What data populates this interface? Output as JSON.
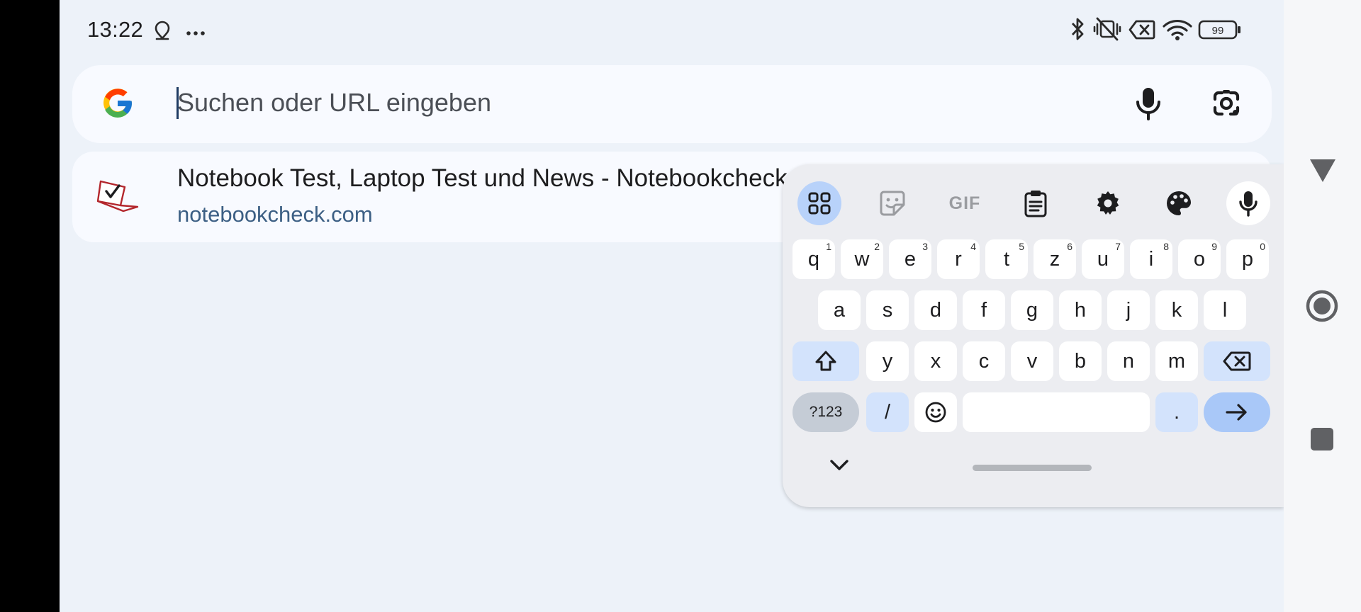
{
  "status_bar": {
    "time": "13:22",
    "battery": "99",
    "icons": [
      "location-icon",
      "more-dots-icon",
      "bluetooth-icon",
      "vibrate-off-icon",
      "no-sim-icon",
      "wifi-icon",
      "battery-icon"
    ]
  },
  "search": {
    "placeholder": "Suchen oder URL eingeben",
    "value": "",
    "icons": [
      "google-logo-icon",
      "microphone-icon",
      "lens-camera-icon"
    ]
  },
  "suggestion": {
    "title": "Notebook Test, Laptop Test und News - Notebookcheck.com",
    "url": "notebookcheck.com",
    "icon": "notebookcheck-favicon"
  },
  "keyboard": {
    "toolbar": [
      "apps-grid-icon",
      "sticker-icon",
      "gif-icon",
      "clipboard-icon",
      "settings-gear-icon",
      "palette-icon",
      "microphone-icon"
    ],
    "gif_label": "GIF",
    "rows": [
      [
        {
          "k": "q",
          "s": "1"
        },
        {
          "k": "w",
          "s": "2"
        },
        {
          "k": "e",
          "s": "3"
        },
        {
          "k": "r",
          "s": "4"
        },
        {
          "k": "t",
          "s": "5"
        },
        {
          "k": "z",
          "s": "6"
        },
        {
          "k": "u",
          "s": "7"
        },
        {
          "k": "i",
          "s": "8"
        },
        {
          "k": "o",
          "s": "9"
        },
        {
          "k": "p",
          "s": "0"
        }
      ],
      [
        {
          "k": "a"
        },
        {
          "k": "s"
        },
        {
          "k": "d"
        },
        {
          "k": "f"
        },
        {
          "k": "g"
        },
        {
          "k": "h"
        },
        {
          "k": "j"
        },
        {
          "k": "k"
        },
        {
          "k": "l"
        }
      ],
      [
        {
          "k": "y"
        },
        {
          "k": "x"
        },
        {
          "k": "c"
        },
        {
          "k": "v"
        },
        {
          "k": "b"
        },
        {
          "k": "n"
        },
        {
          "k": "m"
        }
      ]
    ],
    "bottom": {
      "symbols": "?123",
      "slash": "/",
      "period": "."
    }
  },
  "colors": {
    "screen_bg": "#edf2f9",
    "keyboard_bg": "#ecedf1",
    "accent_key": "#a9c8f8",
    "url_text": "#3c5f84"
  }
}
